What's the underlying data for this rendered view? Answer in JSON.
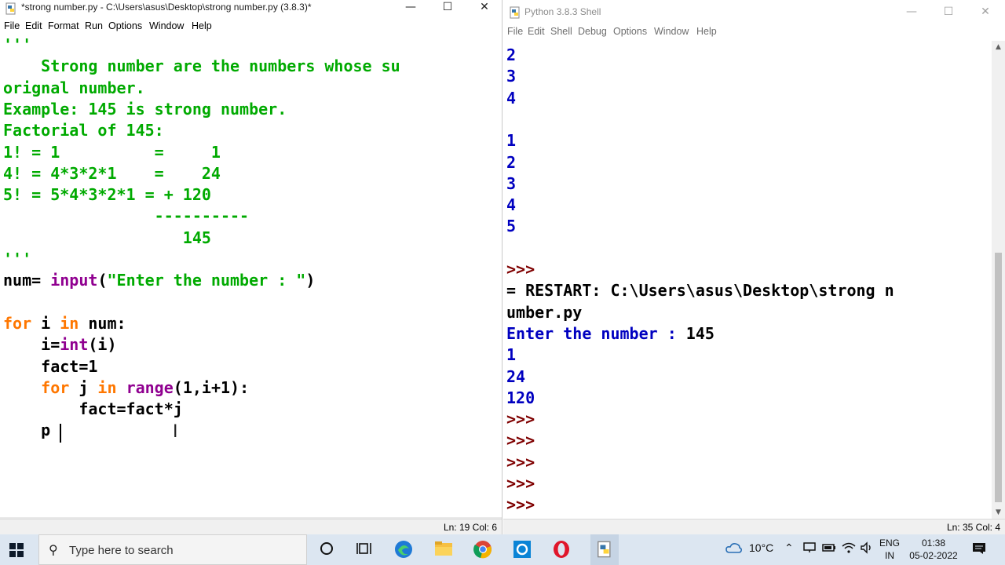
{
  "editor": {
    "title": "*strong number.py - C:\\Users\\asus\\Desktop\\strong number.py (3.8.3)*",
    "menu": [
      "File",
      "Edit",
      "Format",
      "Run",
      "Options",
      "Window",
      "Help"
    ],
    "status": "Ln: 19  Col: 6",
    "lines": [
      [
        {
          "t": "'''",
          "c": "str"
        }
      ],
      [
        {
          "t": "    Strong number are the numbers whose su",
          "c": "str"
        }
      ],
      [
        {
          "t": "orignal number.",
          "c": "str"
        }
      ],
      [
        {
          "t": "Example: 145 is strong number.",
          "c": "str"
        }
      ],
      [
        {
          "t": "Factorial of 145:",
          "c": "str"
        }
      ],
      [
        {
          "t": "1! = 1          =     1",
          "c": "str"
        }
      ],
      [
        {
          "t": "4! = 4*3*2*1    =    24",
          "c": "str"
        }
      ],
      [
        {
          "t": "5! = 5*4*3*2*1 = + 120",
          "c": "str"
        }
      ],
      [
        {
          "t": "                ----------",
          "c": "str"
        }
      ],
      [
        {
          "t": "                   145",
          "c": "str"
        }
      ],
      [
        {
          "t": "'''",
          "c": "str"
        }
      ],
      [
        {
          "t": "num= ",
          "c": "def"
        },
        {
          "t": "input",
          "c": "bi"
        },
        {
          "t": "(",
          "c": "def"
        },
        {
          "t": "\"Enter the number : \"",
          "c": "str"
        },
        {
          "t": ")",
          "c": "def"
        }
      ],
      [],
      [
        {
          "t": "for",
          "c": "kw"
        },
        {
          "t": " i ",
          "c": "def"
        },
        {
          "t": "in",
          "c": "kw"
        },
        {
          "t": " num:",
          "c": "def"
        }
      ],
      [
        {
          "t": "    i=",
          "c": "def"
        },
        {
          "t": "int",
          "c": "bi"
        },
        {
          "t": "(i)",
          "c": "def"
        }
      ],
      [
        {
          "t": "    fact=1",
          "c": "def"
        }
      ],
      [
        {
          "t": "    ",
          "c": "def"
        },
        {
          "t": "for",
          "c": "kw"
        },
        {
          "t": " j ",
          "c": "def"
        },
        {
          "t": "in",
          "c": "kw"
        },
        {
          "t": " ",
          "c": "def"
        },
        {
          "t": "range",
          "c": "bi"
        },
        {
          "t": "(1,i+1):",
          "c": "def"
        }
      ],
      [
        {
          "t": "        fact=fact*j",
          "c": "def"
        }
      ],
      [
        {
          "t": "    p",
          "c": "def"
        }
      ]
    ]
  },
  "shell": {
    "title": "Python 3.8.3 Shell",
    "menu": [
      "File",
      "Edit",
      "Shell",
      "Debug",
      "Options",
      "Window",
      "Help"
    ],
    "status": "Ln: 35  Col: 4",
    "lines": [
      [
        {
          "t": "2",
          "c": "out"
        }
      ],
      [
        {
          "t": "3",
          "c": "out"
        }
      ],
      [
        {
          "t": "4",
          "c": "out"
        }
      ],
      [],
      [
        {
          "t": "1",
          "c": "out"
        }
      ],
      [
        {
          "t": "2",
          "c": "out"
        }
      ],
      [
        {
          "t": "3",
          "c": "out"
        }
      ],
      [
        {
          "t": "4",
          "c": "out"
        }
      ],
      [
        {
          "t": "5",
          "c": "out"
        }
      ],
      [],
      [
        {
          "t": ">>>",
          "c": "prompt"
        }
      ],
      [
        {
          "t": "= RESTART: C:\\Users\\asus\\Desktop\\strong n",
          "c": "restart"
        }
      ],
      [
        {
          "t": "umber.py",
          "c": "restart"
        }
      ],
      [
        {
          "t": "Enter the number : ",
          "c": "out"
        },
        {
          "t": "145",
          "c": "def"
        }
      ],
      [
        {
          "t": "1",
          "c": "out"
        }
      ],
      [
        {
          "t": "24",
          "c": "out"
        }
      ],
      [
        {
          "t": "120",
          "c": "out"
        }
      ],
      [
        {
          "t": ">>>",
          "c": "prompt"
        }
      ],
      [
        {
          "t": ">>>",
          "c": "prompt"
        }
      ],
      [
        {
          "t": ">>>",
          "c": "prompt"
        }
      ],
      [
        {
          "t": ">>>",
          "c": "prompt"
        }
      ],
      [
        {
          "t": ">>>",
          "c": "prompt"
        }
      ]
    ]
  },
  "taskbar": {
    "search_placeholder": "Type here to search",
    "weather": "10°C",
    "lang_top": "ENG",
    "lang_bottom": "IN",
    "time": "01:38",
    "date": "05-02-2022"
  }
}
